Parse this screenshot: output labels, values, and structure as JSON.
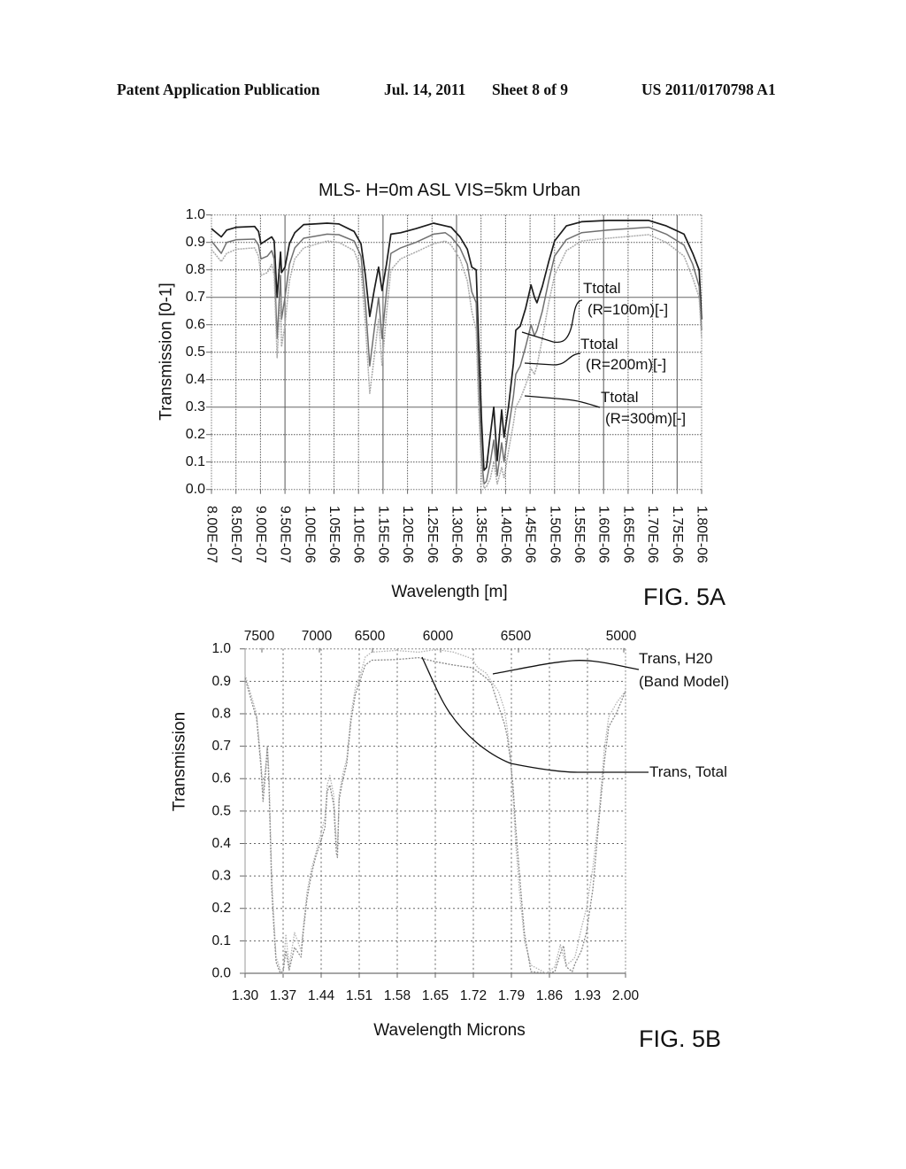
{
  "header": {
    "publication": "Patent Application Publication",
    "date": "Jul. 14, 2011",
    "sheet": "Sheet 8 of 9",
    "number": "US 2011/0170798 A1"
  },
  "chart_data": [
    {
      "figure_label": "FIG. 5A",
      "type": "line",
      "title": "MLS- H=0m ASL VIS=5km Urban",
      "xlabel": "Wavelength [m]",
      "ylabel": "Transmission [0-1]",
      "xlim": [
        8e-07,
        1.8e-06
      ],
      "ylim": [
        0,
        1
      ],
      "grid": true,
      "legend": "inline callout labels (right side of plot)",
      "x_tick_labels": [
        "8.00E-07",
        "8.50E-07",
        "9.00E-07",
        "9.50E-07",
        "1.00E-06",
        "1.05E-06",
        "1.10E-06",
        "1.15E-06",
        "1.20E-06",
        "1.25E-06",
        "1.30E-06",
        "1.35E-06",
        "1.40E-06",
        "1.45E-06",
        "1.50E-06",
        "1.55E-06",
        "1.60E-06",
        "1.65E-06",
        "1.70E-06",
        "1.75E-06",
        "1.80E-06"
      ],
      "y_tick_labels": [
        "0.0",
        "0.1",
        "0.2",
        "0.3",
        "0.4",
        "0.5",
        "0.6",
        "0.7",
        "0.8",
        "0.9",
        "1.0"
      ],
      "x": [
        8e-07,
        8.2e-07,
        8.31e-07,
        8.51e-07,
        8.88e-07,
        8.96e-07,
        9.01e-07,
        9.14e-07,
        9.23e-07,
        9.28e-07,
        9.34e-07,
        9.41e-07,
        9.43e-07,
        9.5e-07,
        9.59e-07,
        9.7e-07,
        9.88e-07,
        1.036e-06,
        1.06e-06,
        1.091e-06,
        1.105e-06,
        1.114e-06,
        1.123e-06,
        1.132e-06,
        1.141e-06,
        1.148e-06,
        1.157e-06,
        1.166e-06,
        1.186e-06,
        1.217e-06,
        1.253e-06,
        1.277e-06,
        1.289e-06,
        1.307e-06,
        1.322e-06,
        1.331e-06,
        1.34e-06,
        1.345e-06,
        1.351e-06,
        1.356e-06,
        1.361e-06,
        1.369e-06,
        1.376e-06,
        1.383e-06,
        1.392e-06,
        1.397e-06,
        1.406e-06,
        1.416e-06,
        1.421e-06,
        1.43e-06,
        1.441e-06,
        1.452e-06,
        1.459e-06,
        1.464e-06,
        1.475e-06,
        1.488e-06,
        1.5e-06,
        1.524e-06,
        1.555e-06,
        1.609e-06,
        1.692e-06,
        1.728e-06,
        1.764e-06,
        1.782e-06,
        1.795e-06,
        1.8e-06
      ],
      "series": [
        {
          "name": "Ttotal (R=100m)[-]",
          "label_lines": [
            "Ttotal",
            "(R=100m)[-]"
          ],
          "callout_target": [
            1.434e-06,
            0.57
          ],
          "y": [
            0.95,
            0.92,
            0.945,
            0.955,
            0.958,
            0.94,
            0.895,
            0.91,
            0.92,
            0.905,
            0.7,
            0.865,
            0.79,
            0.81,
            0.895,
            0.935,
            0.965,
            0.97,
            0.967,
            0.94,
            0.895,
            0.78,
            0.63,
            0.725,
            0.81,
            0.725,
            0.82,
            0.93,
            0.935,
            0.95,
            0.97,
            0.96,
            0.955,
            0.92,
            0.875,
            0.81,
            0.8,
            0.55,
            0.25,
            0.07,
            0.08,
            0.2,
            0.3,
            0.105,
            0.29,
            0.19,
            0.3,
            0.46,
            0.58,
            0.595,
            0.66,
            0.745,
            0.7,
            0.68,
            0.74,
            0.83,
            0.905,
            0.96,
            0.975,
            0.98,
            0.98,
            0.96,
            0.93,
            0.86,
            0.8,
            0.62
          ]
        },
        {
          "name": "Ttotal (R=200m)[-]",
          "label_lines": [
            "Ttotal",
            "(R=200m)[-]"
          ],
          "callout_target": [
            1.439e-06,
            0.46
          ],
          "y": [
            0.905,
            0.86,
            0.9,
            0.91,
            0.912,
            0.89,
            0.84,
            0.85,
            0.87,
            0.84,
            0.55,
            0.78,
            0.62,
            0.7,
            0.82,
            0.88,
            0.915,
            0.93,
            0.928,
            0.905,
            0.85,
            0.68,
            0.45,
            0.58,
            0.7,
            0.55,
            0.72,
            0.86,
            0.88,
            0.9,
            0.93,
            0.935,
            0.92,
            0.88,
            0.82,
            0.72,
            0.68,
            0.4,
            0.12,
            0.02,
            0.03,
            0.1,
            0.18,
            0.05,
            0.17,
            0.1,
            0.22,
            0.34,
            0.42,
            0.45,
            0.52,
            0.6,
            0.56,
            0.58,
            0.65,
            0.76,
            0.85,
            0.91,
            0.935,
            0.945,
            0.955,
            0.93,
            0.89,
            0.82,
            0.74,
            0.58
          ]
        },
        {
          "name": "Ttotal (R=300m)[-]",
          "label_lines": [
            "Ttotal",
            "(R=300m)[-]"
          ],
          "callout_target": [
            1.439e-06,
            0.34
          ],
          "y": [
            0.874,
            0.83,
            0.86,
            0.875,
            0.88,
            0.85,
            0.78,
            0.79,
            0.82,
            0.78,
            0.48,
            0.7,
            0.52,
            0.6,
            0.76,
            0.84,
            0.88,
            0.905,
            0.9,
            0.87,
            0.8,
            0.6,
            0.35,
            0.48,
            0.62,
            0.45,
            0.64,
            0.8,
            0.84,
            0.865,
            0.895,
            0.905,
            0.89,
            0.84,
            0.76,
            0.65,
            0.58,
            0.3,
            0.06,
            0.005,
            0.01,
            0.04,
            0.1,
            0.02,
            0.08,
            0.04,
            0.14,
            0.24,
            0.3,
            0.33,
            0.38,
            0.44,
            0.42,
            0.45,
            0.55,
            0.68,
            0.78,
            0.87,
            0.905,
            0.915,
            0.928,
            0.9,
            0.85,
            0.77,
            0.7,
            0.55
          ]
        }
      ]
    },
    {
      "figure_label": "FIG. 5B",
      "type": "line",
      "title": "",
      "xlabel": "Wavelength Microns",
      "ylabel": "Transmission",
      "xlim": [
        1.3,
        2.0
      ],
      "ylim": [
        0,
        1
      ],
      "grid": true,
      "legend": "inline callout labels (right side of plot)",
      "x_tick_labels": [
        "1.30",
        "1.37",
        "1.44",
        "1.51",
        "1.58",
        "1.65",
        "1.72",
        "1.79",
        "1.86",
        "1.93",
        "2.00"
      ],
      "y_tick_labels": [
        "0.0",
        "0.1",
        "0.2",
        "0.3",
        "0.4",
        "0.5",
        "0.6",
        "0.7",
        "0.8",
        "0.9",
        "1.0"
      ],
      "top_axis_labels": [
        "7500",
        "7000",
        "6500",
        "6000",
        "6500",
        "5000"
      ],
      "x": [
        1.3,
        1.316,
        1.321,
        1.329,
        1.333,
        1.338,
        1.341,
        1.344,
        1.349,
        1.352,
        1.357,
        1.365,
        1.37,
        1.375,
        1.381,
        1.391,
        1.403,
        1.407,
        1.414,
        1.422,
        1.43,
        1.438,
        1.447,
        1.451,
        1.456,
        1.463,
        1.468,
        1.47,
        1.473,
        1.479,
        1.487,
        1.495,
        1.503,
        1.512,
        1.521,
        1.533,
        1.577,
        1.619,
        1.652,
        1.684,
        1.717,
        1.728,
        1.744,
        1.753,
        1.766,
        1.777,
        1.782,
        1.788,
        1.793,
        1.798,
        1.805,
        1.81,
        1.814,
        1.826,
        1.854,
        1.87,
        1.88,
        1.886,
        1.891,
        1.902,
        1.907,
        1.919,
        1.928,
        1.94,
        1.951,
        1.961,
        1.969,
        1.984,
        2.0
      ],
      "series": [
        {
          "name": "Trans, H20 (Band Model)",
          "label_lines": [
            "Trans, H20",
            "(Band Model)"
          ],
          "callout_target": [
            1.756,
            0.92
          ],
          "y": [
            0.92,
            0.83,
            0.8,
            0.66,
            0.56,
            0.64,
            0.7,
            0.62,
            0.3,
            0.2,
            0.05,
            0.01,
            0.0,
            0.12,
            0.02,
            0.125,
            0.07,
            0.14,
            0.25,
            0.32,
            0.37,
            0.42,
            0.48,
            0.58,
            0.61,
            0.55,
            0.4,
            0.38,
            0.55,
            0.61,
            0.66,
            0.8,
            0.88,
            0.92,
            0.975,
            0.99,
            0.995,
            0.99,
            0.998,
            0.99,
            0.97,
            0.942,
            0.925,
            0.9,
            0.87,
            0.815,
            0.76,
            0.67,
            0.55,
            0.4,
            0.25,
            0.17,
            0.1,
            0.025,
            0.0,
            0.02,
            0.088,
            0.05,
            0.025,
            0.04,
            0.05,
            0.14,
            0.2,
            0.325,
            0.49,
            0.69,
            0.79,
            0.835,
            0.87
          ]
        },
        {
          "name": "Trans, Total",
          "label_lines": [
            "Trans, Total"
          ],
          "callout_target": [
            1.625,
            0.974
          ],
          "y": [
            0.91,
            0.815,
            0.79,
            0.64,
            0.53,
            0.62,
            0.7,
            0.58,
            0.26,
            0.17,
            0.035,
            0.0,
            0.005,
            0.07,
            0.01,
            0.08,
            0.05,
            0.125,
            0.23,
            0.305,
            0.36,
            0.4,
            0.45,
            0.56,
            0.58,
            0.52,
            0.37,
            0.357,
            0.535,
            0.59,
            0.645,
            0.78,
            0.86,
            0.905,
            0.95,
            0.965,
            0.967,
            0.973,
            0.96,
            0.95,
            0.942,
            0.93,
            0.91,
            0.895,
            0.825,
            0.77,
            0.733,
            0.66,
            0.58,
            0.45,
            0.305,
            0.2,
            0.125,
            0.005,
            0.0,
            0.005,
            0.06,
            0.085,
            0.02,
            0.005,
            0.03,
            0.07,
            0.125,
            0.26,
            0.47,
            0.65,
            0.76,
            0.805,
            0.87
          ]
        }
      ]
    }
  ]
}
